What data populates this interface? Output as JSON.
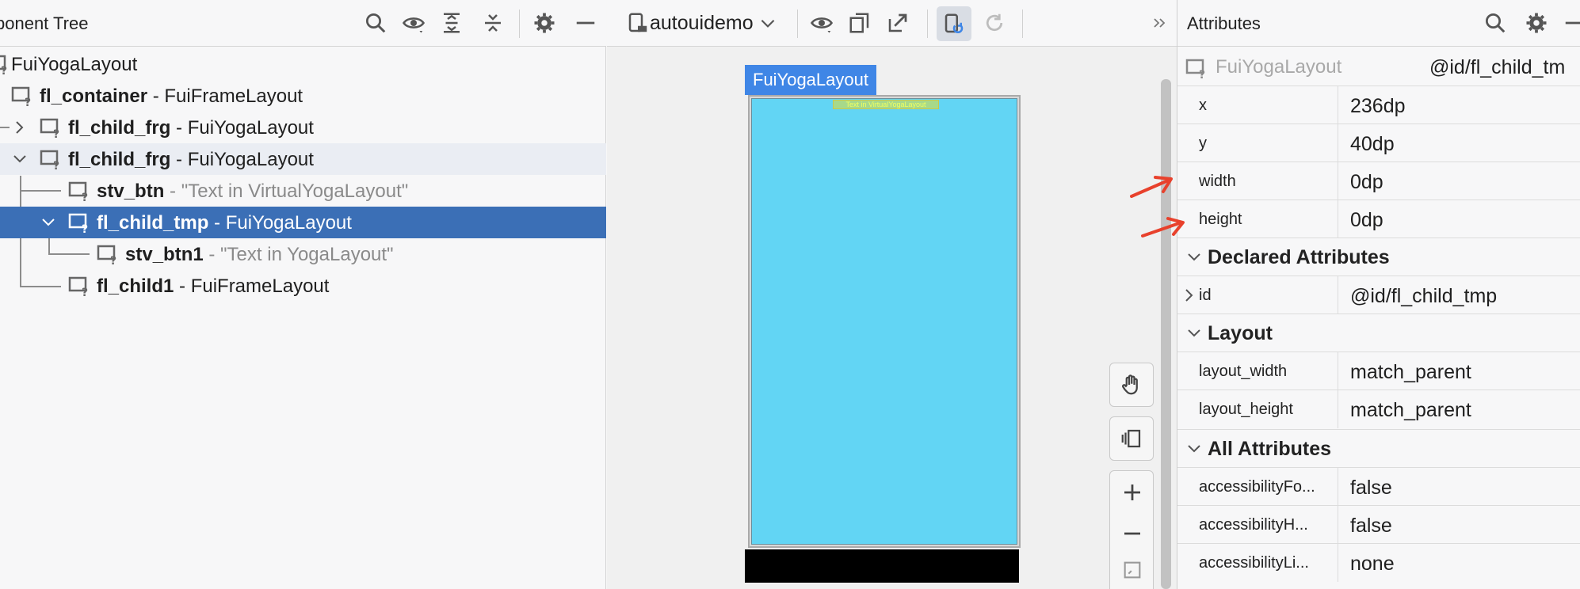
{
  "tree": {
    "title": "ponent Tree",
    "rows": [
      {
        "name": "FuiYogaLayout",
        "type": ""
      },
      {
        "name": "fl_container",
        "type": " - FuiFrameLayout"
      },
      {
        "name": "fl_child_frg",
        "type": " - FuiYogaLayout"
      },
      {
        "name": "fl_child_frg",
        "type": " - FuiYogaLayout"
      },
      {
        "name": "stv_btn",
        "type": " - \"Text in VirtualYogaLayout\""
      },
      {
        "name": "fl_child_tmp",
        "type": " - FuiYogaLayout"
      },
      {
        "name": "stv_btn1",
        "type": " - \"Text in YogaLayout\""
      },
      {
        "name": "fl_child1",
        "type": " - FuiFrameLayout"
      }
    ]
  },
  "preview": {
    "device": "autouidemo",
    "badge": "FuiYogaLayout",
    "inner_text": "Text in VirtualYogaLayout"
  },
  "attributes": {
    "title": "Attributes",
    "component_name": "FuiYogaLayout",
    "component_id": "@id/fl_child_tm",
    "top_rows": [
      {
        "key": "x",
        "value": "236dp"
      },
      {
        "key": "y",
        "value": "40dp"
      },
      {
        "key": "width",
        "value": "0dp"
      },
      {
        "key": "height",
        "value": "0dp"
      }
    ],
    "declared": {
      "title": "Declared Attributes",
      "rows": [
        {
          "key": "id",
          "value": "@id/fl_child_tmp"
        }
      ]
    },
    "layout": {
      "title": "Layout",
      "rows": [
        {
          "key": "layout_width",
          "value": "match_parent"
        },
        {
          "key": "layout_height",
          "value": "match_parent"
        }
      ]
    },
    "all": {
      "title": "All Attributes",
      "rows": [
        {
          "key": "accessibilityFo...",
          "value": "false"
        },
        {
          "key": "accessibilityH...",
          "value": "false"
        },
        {
          "key": "accessibilityLi...",
          "value": "none"
        }
      ]
    }
  },
  "colors": {
    "selection": "#3b6fb6",
    "badge": "#3f86e6",
    "screen": "#62d5f4",
    "annotation_arrow": "#e8412c"
  },
  "icons": [
    "search-icon",
    "eye-icon",
    "expand-all-icon",
    "collapse-all-icon",
    "gear-icon",
    "minimize-icon",
    "device-icon",
    "chevron-down-icon",
    "export-icon",
    "share-icon",
    "live-update-icon",
    "refresh-icon",
    "double-chevron-right-icon",
    "hand-icon",
    "layers-icon",
    "zoom-in-icon",
    "zoom-out-icon",
    "fit-screen-icon",
    "view-node-icon"
  ]
}
